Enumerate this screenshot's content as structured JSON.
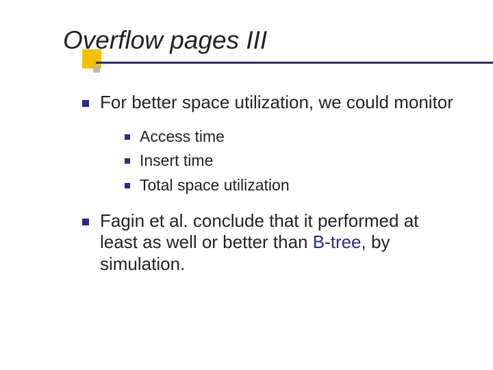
{
  "slide": {
    "title": "Overflow pages III",
    "bullets": [
      {
        "text": "For better space utilization, we could monitor",
        "sub": [
          "Access time",
          "Insert time",
          "Total space utilization"
        ]
      },
      {
        "pre": "Fagin et al. conclude that it performed at least as well or better than ",
        "highlight": "B-tree",
        "post": ", by simulation."
      }
    ]
  }
}
